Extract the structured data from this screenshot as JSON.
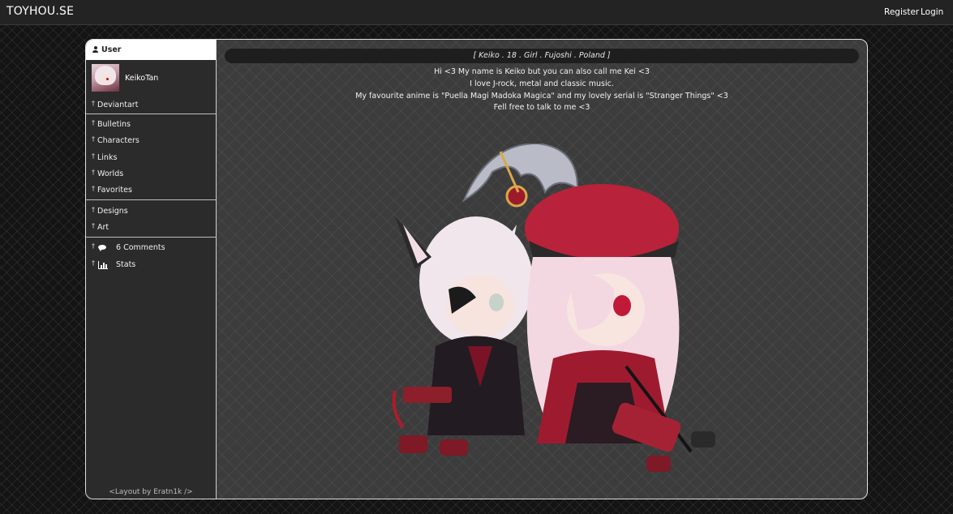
{
  "site": {
    "brand": "TOYHOU.SE",
    "register_label": "Register",
    "login_label": "Login"
  },
  "sidebar": {
    "header_label": "User",
    "username": "KeikoTan",
    "groups": [
      {
        "items": [
          {
            "label": "Deviantart"
          }
        ]
      },
      {
        "items": [
          {
            "label": "Bulletins"
          },
          {
            "label": "Characters"
          },
          {
            "label": "Links"
          },
          {
            "label": "Worlds"
          },
          {
            "label": "Favorites"
          }
        ]
      },
      {
        "items": [
          {
            "label": "Designs"
          },
          {
            "label": "Art"
          }
        ]
      },
      {
        "items": [
          {
            "label": "6 Comments",
            "icon": "speech-bubble-icon"
          },
          {
            "label": "Stats",
            "icon": "bar-chart-icon"
          }
        ]
      }
    ],
    "footer_credit": "<Layout by Eratn1k />"
  },
  "profile": {
    "title": "[ Keiko . 18 . Girl . Fujoshi . Poland ]",
    "bio_lines": [
      "Hi <3 My name is Keiko but you can also call me Kei <3",
      "I love J-rock, metal and classic music.",
      "My favourite anime is \"Puella Magi Madoka Magica\" and my lovely serial is \"Stranger Things\" <3",
      "Fell free to talk to me <3"
    ]
  },
  "colors": {
    "page_bg": "#141414",
    "panel_bg": "#3c3c3c",
    "sidebar_bg": "#2b2b2b",
    "accent_red": "#c4263a"
  }
}
